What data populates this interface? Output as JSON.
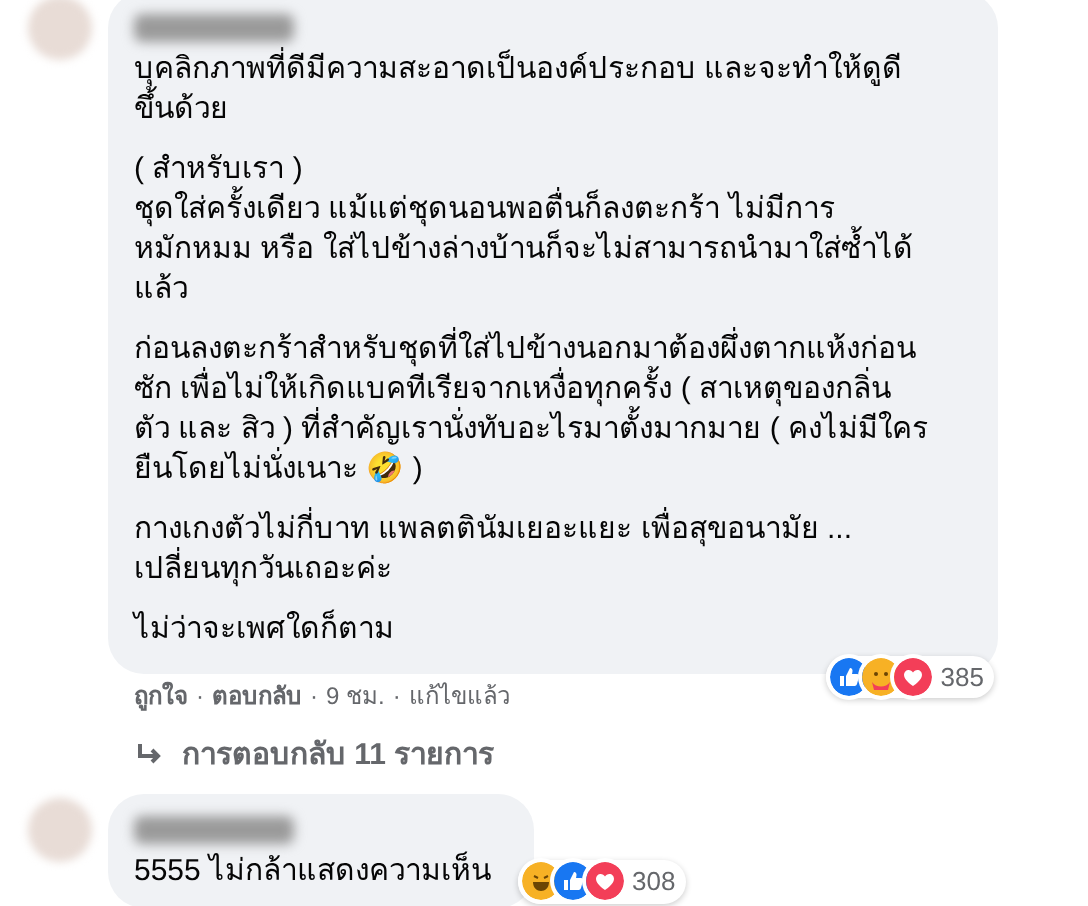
{
  "comments": [
    {
      "paragraphs": [
        [
          "บุคลิกภาพที่ดีมีความสะอาดเป็นองค์ประกอบ และจะทำให้ดูดี",
          "ขึ้นด้วย"
        ],
        [
          "( สำหรับเรา )",
          "ชุดใส่ครั้งเดียว แม้แต่ชุดนอนพอตื่นก็ลงตะกร้า ไม่มีการ",
          "หมักหมม หรือ ใส่ไปข้างล่างบ้านก็จะไม่สามารถนำมาใส่ซ้ำได้",
          "แล้ว"
        ],
        [
          "ก่อนลงตะกร้าสำหรับชุดที่ใส่ไปข้างนอกมาต้องผึ่งตากแห้งก่อน",
          "ซัก เพื่อไม่ให้เกิดแบคทีเรียจากเหงื่อทุกครั้ง ( สาเหตุของกลิ่น",
          "ตัว และ สิว ) ที่สำคัญเรานั่งทับอะไรมาตั้งมากมาย ( คงไม่มีใคร",
          "ยืนโดยไม่นั่งเนาะ 🤣 )"
        ],
        [
          "กางเกงตัวไม่กี่บาท แพลตตินัมเยอะแยะ เพื่อสุขอนามัย ...",
          "เปลี่ยนทุกวันเถอะค่ะ"
        ],
        [
          "ไม่ว่าจะเพศใดก็ตาม"
        ]
      ],
      "reactions": [
        {
          "kind": "like"
        },
        {
          "kind": "care"
        },
        {
          "kind": "love"
        }
      ],
      "reaction_count": "385",
      "actions": [
        "ถูกใจ",
        "ตอบกลับ",
        "9 ชม.",
        "แก้ไขแล้ว"
      ],
      "separator": "·",
      "replies_link": "การตอบกลับ 11 รายการ"
    },
    {
      "paragraphs": [
        [
          "5555 ไม่กล้าแสดงความเห็น"
        ]
      ],
      "reactions": [
        {
          "kind": "haha"
        },
        {
          "kind": "like"
        },
        {
          "kind": "love"
        }
      ],
      "reaction_count": "308"
    }
  ]
}
